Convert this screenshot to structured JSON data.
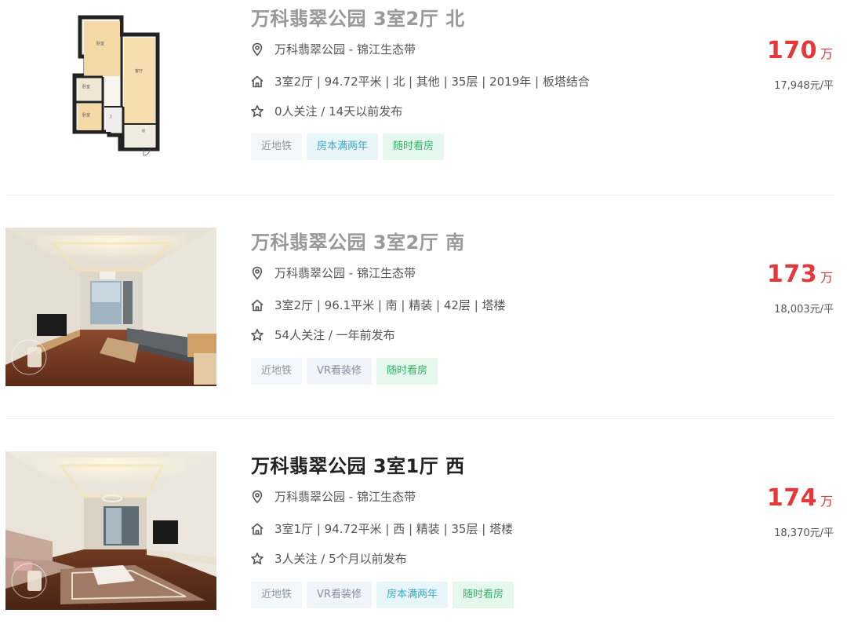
{
  "listings": [
    {
      "title": "万科翡翠公园 3室2厅 北",
      "title_color": "#999999",
      "image": "floorplan",
      "community": "万科翡翠公园 - 锦江生态带",
      "house_info": "3室2厅 | 94.72平米 | 北 | 其他 | 35层 | 2019年 | 板塔结合",
      "follow_info": "0人关注 / 14天以前发布",
      "tags": [
        {
          "label": "近地铁",
          "kind": "subway"
        },
        {
          "label": "房本满两年",
          "kind": "taxfree"
        },
        {
          "label": "随时看房",
          "kind": "haskey"
        }
      ],
      "total_price": "170",
      "price_unit": "万",
      "unit_price": "17,948元/平"
    },
    {
      "title": "万科翡翠公园 3室2厅 南",
      "title_color": "#999999",
      "image": "living-room-photo",
      "community": "万科翡翠公园 - 锦江生态带",
      "house_info": "3室2厅 | 96.1平米 | 南 | 精装 | 42层 | 塔楼",
      "follow_info": "54人关注 / 一年前发布",
      "tags": [
        {
          "label": "近地铁",
          "kind": "subway"
        },
        {
          "label": "VR看装修",
          "kind": "vr"
        },
        {
          "label": "随时看房",
          "kind": "haskey"
        }
      ],
      "total_price": "173",
      "price_unit": "万",
      "unit_price": "18,003元/平"
    },
    {
      "title": "万科翡翠公园 3室1厅 西",
      "title_color": "#222222",
      "image": "living-room-photo",
      "community": "万科翡翠公园 - 锦江生态带",
      "house_info": "3室1厅 | 94.72平米 | 西 | 精装 | 35层 | 塔楼",
      "follow_info": "3人关注 / 5个月以前发布",
      "tags": [
        {
          "label": "近地铁",
          "kind": "subway"
        },
        {
          "label": "VR看装修",
          "kind": "vr"
        },
        {
          "label": "房本满两年",
          "kind": "taxfree"
        },
        {
          "label": "随时看房",
          "kind": "haskey"
        }
      ],
      "total_price": "174",
      "price_unit": "万",
      "unit_price": "18,370元/平"
    }
  ],
  "icons": {
    "location": "location-pin-icon",
    "house": "house-icon",
    "follow": "star-icon"
  },
  "colors": {
    "price": "#e4393c",
    "info_text": "#555555"
  }
}
